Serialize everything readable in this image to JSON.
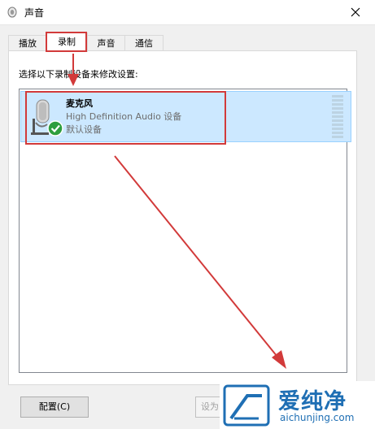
{
  "window": {
    "title": "声音",
    "icon": "speaker-icon",
    "close": "close-icon"
  },
  "tabs": [
    {
      "label": "播放",
      "active": false
    },
    {
      "label": "录制",
      "active": true
    },
    {
      "label": "声音",
      "active": false
    },
    {
      "label": "通信",
      "active": false
    }
  ],
  "instruction": "选择以下录制设备来修改设置:",
  "device": {
    "name": "麦克风",
    "description": "High Definition Audio 设备",
    "status": "默认设备",
    "icon": "microphone-icon",
    "badge": "check-icon",
    "selected": true
  },
  "buttons": {
    "configure": "配置(C)",
    "set_default": "设为"
  },
  "watermark": {
    "brand": "爱纯净",
    "url": "aichunjing.com",
    "logo": "site-logo"
  },
  "colors": {
    "selection": "#cce8ff",
    "annotation": "#d23a3a",
    "check": "#2e9e3e",
    "watermark": "#1f6fb4"
  }
}
